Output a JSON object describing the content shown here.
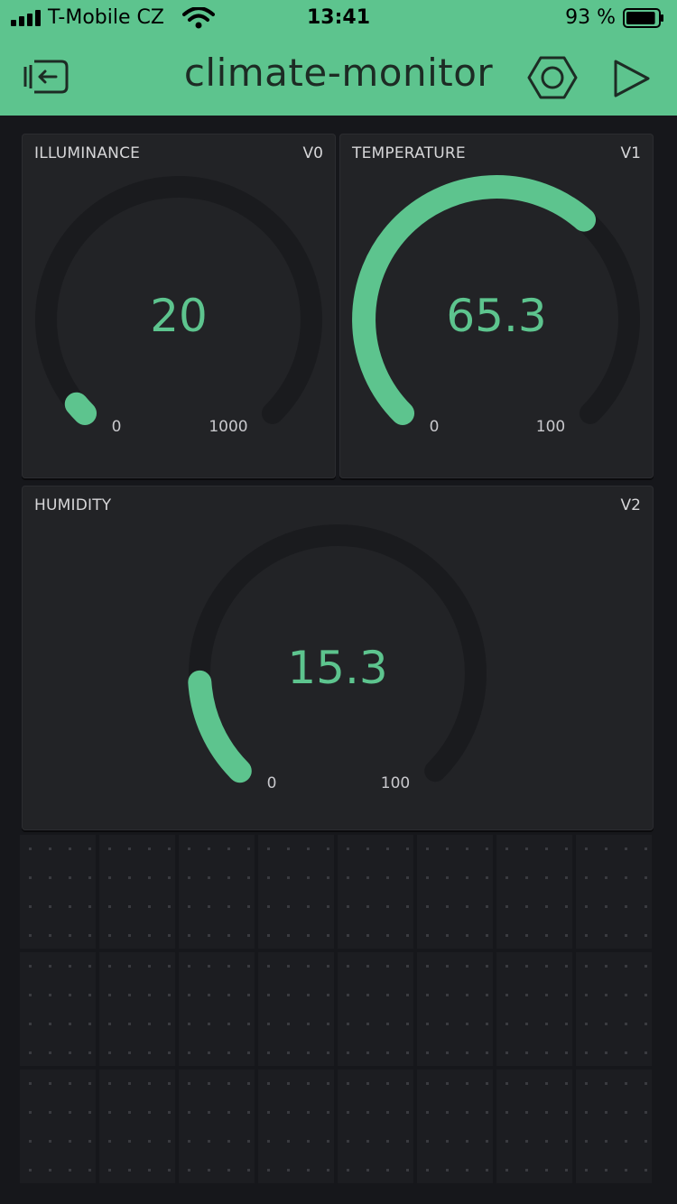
{
  "status_bar": {
    "carrier": "T-Mobile CZ",
    "time": "13:41",
    "battery": "93 %",
    "battery_level": 0.93
  },
  "header": {
    "title": "climate-monitor",
    "back_icon": "exit-icon",
    "settings_icon": "hexagon-settings-icon",
    "play_icon": "play-icon"
  },
  "colors": {
    "accent": "#5dc48e",
    "widget_bg": "#222326",
    "track": "#1a1b1e",
    "page_bg": "#16171b"
  },
  "widgets": [
    {
      "label": "ILLUMINANCE",
      "pin": "V0",
      "value": "20",
      "min": "0",
      "max": "1000",
      "fraction": 0.02
    },
    {
      "label": "TEMPERATURE",
      "pin": "V1",
      "value": "65.3",
      "min": "0",
      "max": "100",
      "fraction": 0.653
    },
    {
      "label": "HUMIDITY",
      "pin": "V2",
      "value": "15.3",
      "min": "0",
      "max": "100",
      "fraction": 0.153
    }
  ]
}
